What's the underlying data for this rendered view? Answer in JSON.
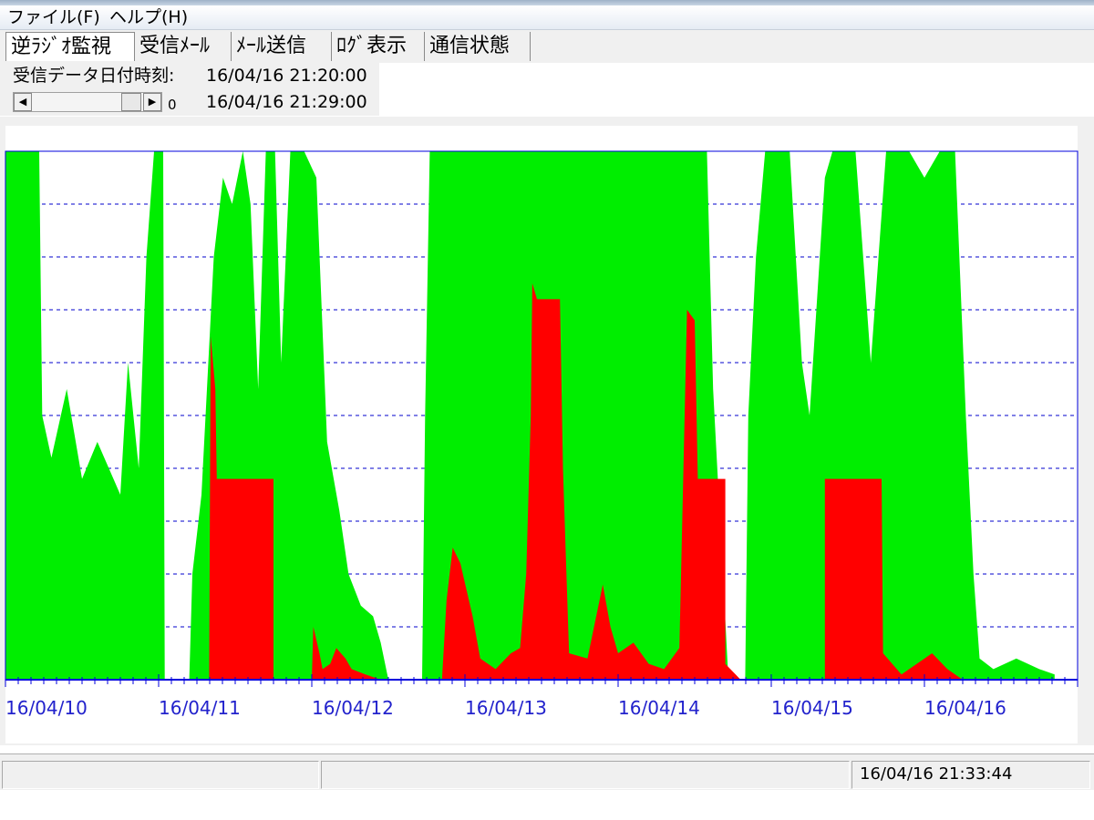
{
  "menu": {
    "file": "ファイル(F)",
    "help": "ヘルプ(H)"
  },
  "tabs": [
    {
      "label": "逆ﾗｼﾞｵ監視",
      "active": true
    },
    {
      "label": "受信ﾒｰﾙ",
      "active": false
    },
    {
      "label": "ﾒｰﾙ送信",
      "active": false
    },
    {
      "label": "ﾛｸﾞ表示",
      "active": false
    },
    {
      "label": "通信状態",
      "active": false
    }
  ],
  "info": {
    "received_label": "受信データ日付時刻:",
    "received_time": "16/04/16 21:20:00",
    "slider_time": "16/04/16 21:29:00",
    "slider_value": "0"
  },
  "statusbar": {
    "time": "16/04/16 21:33:44"
  },
  "colors": {
    "green_series": "#00ee00",
    "red_series": "#ff0000",
    "axis": "#0000dd",
    "grid": "#0000cc",
    "date_label": "#2222cc"
  },
  "chart_data": {
    "type": "area",
    "categories": [
      "16/04/10",
      "16/04/11",
      "16/04/12",
      "16/04/13",
      "16/04/14",
      "16/04/15",
      "16/04/16"
    ],
    "x_range_days": [
      0,
      7.0
    ],
    "y_range": [
      0,
      10
    ],
    "grid": "horizontal-dashed",
    "series": [
      {
        "key": "green",
        "points": [
          [
            0.0,
            10
          ],
          [
            0.22,
            10
          ],
          [
            0.24,
            5.0
          ],
          [
            0.3,
            4.2
          ],
          [
            0.4,
            5.5
          ],
          [
            0.5,
            3.8
          ],
          [
            0.6,
            4.5
          ],
          [
            0.75,
            3.5
          ],
          [
            0.8,
            6.0
          ],
          [
            0.87,
            4.0
          ],
          [
            0.92,
            8.0
          ],
          [
            0.97,
            10
          ],
          [
            1.03,
            10
          ],
          [
            1.04,
            0
          ],
          [
            1.2,
            0
          ],
          [
            1.22,
            2.0
          ],
          [
            1.28,
            3.5
          ],
          [
            1.36,
            8.0
          ],
          [
            1.42,
            9.5
          ],
          [
            1.48,
            9.0
          ],
          [
            1.55,
            10
          ],
          [
            1.6,
            9.0
          ],
          [
            1.65,
            5.5
          ],
          [
            1.7,
            10
          ],
          [
            1.76,
            10
          ],
          [
            1.8,
            6.0
          ],
          [
            1.86,
            10
          ],
          [
            1.95,
            10
          ],
          [
            2.03,
            9.5
          ],
          [
            2.1,
            4.5
          ],
          [
            2.18,
            3.2
          ],
          [
            2.24,
            2.0
          ],
          [
            2.32,
            1.4
          ],
          [
            2.4,
            1.2
          ],
          [
            2.45,
            0.7
          ],
          [
            2.5,
            0
          ],
          [
            2.72,
            0
          ],
          [
            2.74,
            5.0
          ],
          [
            2.77,
            10
          ],
          [
            3.05,
            10
          ],
          [
            3.6,
            10
          ],
          [
            4.05,
            10
          ],
          [
            4.4,
            10
          ],
          [
            4.5,
            10
          ],
          [
            4.58,
            10
          ],
          [
            4.62,
            5.5
          ],
          [
            4.72,
            0
          ],
          [
            4.83,
            0
          ],
          [
            4.85,
            5.0
          ],
          [
            4.9,
            8.0
          ],
          [
            4.96,
            10
          ],
          [
            5.12,
            10
          ],
          [
            5.2,
            6.0
          ],
          [
            5.25,
            5.0
          ],
          [
            5.35,
            9.5
          ],
          [
            5.4,
            10
          ],
          [
            5.55,
            10
          ],
          [
            5.65,
            6.0
          ],
          [
            5.75,
            10
          ],
          [
            5.9,
            10
          ],
          [
            6.0,
            9.5
          ],
          [
            6.1,
            10
          ],
          [
            6.2,
            10
          ],
          [
            6.27,
            5.0
          ],
          [
            6.32,
            2.0
          ],
          [
            6.36,
            0.4
          ],
          [
            6.45,
            0.2
          ],
          [
            6.6,
            0.4
          ],
          [
            6.75,
            0.2
          ],
          [
            6.85,
            0.1
          ]
        ]
      },
      {
        "key": "red",
        "points": [
          [
            1.33,
            0
          ],
          [
            1.34,
            6.5
          ],
          [
            1.37,
            5.5
          ],
          [
            1.38,
            3.8
          ],
          [
            1.75,
            3.8
          ],
          [
            1.75,
            0
          ],
          [
            2.0,
            0
          ],
          [
            2.01,
            1.0
          ],
          [
            2.05,
            0.5
          ],
          [
            2.07,
            0.2
          ],
          [
            2.12,
            0.3
          ],
          [
            2.16,
            0.6
          ],
          [
            2.22,
            0.4
          ],
          [
            2.26,
            0.2
          ],
          [
            2.35,
            0.1
          ],
          [
            2.45,
            0
          ],
          [
            2.85,
            0
          ],
          [
            2.88,
            1.5
          ],
          [
            2.92,
            2.5
          ],
          [
            2.97,
            2.2
          ],
          [
            3.05,
            1.2
          ],
          [
            3.1,
            0.4
          ],
          [
            3.2,
            0.2
          ],
          [
            3.3,
            0.5
          ],
          [
            3.36,
            0.6
          ],
          [
            3.4,
            2.0
          ],
          [
            3.43,
            5.0
          ],
          [
            3.44,
            7.5
          ],
          [
            3.47,
            7.2
          ],
          [
            3.62,
            7.2
          ],
          [
            3.64,
            4.0
          ],
          [
            3.68,
            0.5
          ],
          [
            3.8,
            0.4
          ],
          [
            3.9,
            1.8
          ],
          [
            3.95,
            1.0
          ],
          [
            4.0,
            0.5
          ],
          [
            4.1,
            0.7
          ],
          [
            4.2,
            0.3
          ],
          [
            4.3,
            0.2
          ],
          [
            4.4,
            0.6
          ],
          [
            4.45,
            7.0
          ],
          [
            4.5,
            6.8
          ],
          [
            4.52,
            3.8
          ],
          [
            4.7,
            3.8
          ],
          [
            4.7,
            0.3
          ],
          [
            4.8,
            0
          ],
          [
            5.35,
            0
          ],
          [
            5.35,
            3.8
          ],
          [
            5.72,
            3.8
          ],
          [
            5.73,
            0.5
          ],
          [
            5.85,
            0.1
          ],
          [
            5.95,
            0.3
          ],
          [
            6.05,
            0.5
          ],
          [
            6.15,
            0.2
          ],
          [
            6.25,
            0
          ]
        ]
      }
    ]
  }
}
